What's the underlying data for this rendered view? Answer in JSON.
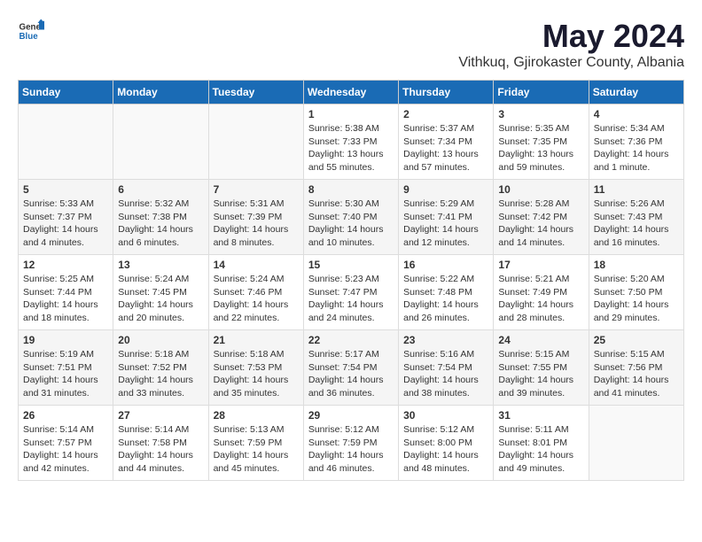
{
  "header": {
    "logo_general": "General",
    "logo_blue": "Blue",
    "month_year": "May 2024",
    "location": "Vithkuq, Gjirokaster County, Albania"
  },
  "days_of_week": [
    "Sunday",
    "Monday",
    "Tuesday",
    "Wednesday",
    "Thursday",
    "Friday",
    "Saturday"
  ],
  "weeks": [
    [
      {
        "day": null,
        "sunrise": null,
        "sunset": null,
        "daylight": null
      },
      {
        "day": null,
        "sunrise": null,
        "sunset": null,
        "daylight": null
      },
      {
        "day": null,
        "sunrise": null,
        "sunset": null,
        "daylight": null
      },
      {
        "day": "1",
        "sunrise": "Sunrise: 5:38 AM",
        "sunset": "Sunset: 7:33 PM",
        "daylight": "Daylight: 13 hours and 55 minutes."
      },
      {
        "day": "2",
        "sunrise": "Sunrise: 5:37 AM",
        "sunset": "Sunset: 7:34 PM",
        "daylight": "Daylight: 13 hours and 57 minutes."
      },
      {
        "day": "3",
        "sunrise": "Sunrise: 5:35 AM",
        "sunset": "Sunset: 7:35 PM",
        "daylight": "Daylight: 13 hours and 59 minutes."
      },
      {
        "day": "4",
        "sunrise": "Sunrise: 5:34 AM",
        "sunset": "Sunset: 7:36 PM",
        "daylight": "Daylight: 14 hours and 1 minute."
      }
    ],
    [
      {
        "day": "5",
        "sunrise": "Sunrise: 5:33 AM",
        "sunset": "Sunset: 7:37 PM",
        "daylight": "Daylight: 14 hours and 4 minutes."
      },
      {
        "day": "6",
        "sunrise": "Sunrise: 5:32 AM",
        "sunset": "Sunset: 7:38 PM",
        "daylight": "Daylight: 14 hours and 6 minutes."
      },
      {
        "day": "7",
        "sunrise": "Sunrise: 5:31 AM",
        "sunset": "Sunset: 7:39 PM",
        "daylight": "Daylight: 14 hours and 8 minutes."
      },
      {
        "day": "8",
        "sunrise": "Sunrise: 5:30 AM",
        "sunset": "Sunset: 7:40 PM",
        "daylight": "Daylight: 14 hours and 10 minutes."
      },
      {
        "day": "9",
        "sunrise": "Sunrise: 5:29 AM",
        "sunset": "Sunset: 7:41 PM",
        "daylight": "Daylight: 14 hours and 12 minutes."
      },
      {
        "day": "10",
        "sunrise": "Sunrise: 5:28 AM",
        "sunset": "Sunset: 7:42 PM",
        "daylight": "Daylight: 14 hours and 14 minutes."
      },
      {
        "day": "11",
        "sunrise": "Sunrise: 5:26 AM",
        "sunset": "Sunset: 7:43 PM",
        "daylight": "Daylight: 14 hours and 16 minutes."
      }
    ],
    [
      {
        "day": "12",
        "sunrise": "Sunrise: 5:25 AM",
        "sunset": "Sunset: 7:44 PM",
        "daylight": "Daylight: 14 hours and 18 minutes."
      },
      {
        "day": "13",
        "sunrise": "Sunrise: 5:24 AM",
        "sunset": "Sunset: 7:45 PM",
        "daylight": "Daylight: 14 hours and 20 minutes."
      },
      {
        "day": "14",
        "sunrise": "Sunrise: 5:24 AM",
        "sunset": "Sunset: 7:46 PM",
        "daylight": "Daylight: 14 hours and 22 minutes."
      },
      {
        "day": "15",
        "sunrise": "Sunrise: 5:23 AM",
        "sunset": "Sunset: 7:47 PM",
        "daylight": "Daylight: 14 hours and 24 minutes."
      },
      {
        "day": "16",
        "sunrise": "Sunrise: 5:22 AM",
        "sunset": "Sunset: 7:48 PM",
        "daylight": "Daylight: 14 hours and 26 minutes."
      },
      {
        "day": "17",
        "sunrise": "Sunrise: 5:21 AM",
        "sunset": "Sunset: 7:49 PM",
        "daylight": "Daylight: 14 hours and 28 minutes."
      },
      {
        "day": "18",
        "sunrise": "Sunrise: 5:20 AM",
        "sunset": "Sunset: 7:50 PM",
        "daylight": "Daylight: 14 hours and 29 minutes."
      }
    ],
    [
      {
        "day": "19",
        "sunrise": "Sunrise: 5:19 AM",
        "sunset": "Sunset: 7:51 PM",
        "daylight": "Daylight: 14 hours and 31 minutes."
      },
      {
        "day": "20",
        "sunrise": "Sunrise: 5:18 AM",
        "sunset": "Sunset: 7:52 PM",
        "daylight": "Daylight: 14 hours and 33 minutes."
      },
      {
        "day": "21",
        "sunrise": "Sunrise: 5:18 AM",
        "sunset": "Sunset: 7:53 PM",
        "daylight": "Daylight: 14 hours and 35 minutes."
      },
      {
        "day": "22",
        "sunrise": "Sunrise: 5:17 AM",
        "sunset": "Sunset: 7:54 PM",
        "daylight": "Daylight: 14 hours and 36 minutes."
      },
      {
        "day": "23",
        "sunrise": "Sunrise: 5:16 AM",
        "sunset": "Sunset: 7:54 PM",
        "daylight": "Daylight: 14 hours and 38 minutes."
      },
      {
        "day": "24",
        "sunrise": "Sunrise: 5:15 AM",
        "sunset": "Sunset: 7:55 PM",
        "daylight": "Daylight: 14 hours and 39 minutes."
      },
      {
        "day": "25",
        "sunrise": "Sunrise: 5:15 AM",
        "sunset": "Sunset: 7:56 PM",
        "daylight": "Daylight: 14 hours and 41 minutes."
      }
    ],
    [
      {
        "day": "26",
        "sunrise": "Sunrise: 5:14 AM",
        "sunset": "Sunset: 7:57 PM",
        "daylight": "Daylight: 14 hours and 42 minutes."
      },
      {
        "day": "27",
        "sunrise": "Sunrise: 5:14 AM",
        "sunset": "Sunset: 7:58 PM",
        "daylight": "Daylight: 14 hours and 44 minutes."
      },
      {
        "day": "28",
        "sunrise": "Sunrise: 5:13 AM",
        "sunset": "Sunset: 7:59 PM",
        "daylight": "Daylight: 14 hours and 45 minutes."
      },
      {
        "day": "29",
        "sunrise": "Sunrise: 5:12 AM",
        "sunset": "Sunset: 7:59 PM",
        "daylight": "Daylight: 14 hours and 46 minutes."
      },
      {
        "day": "30",
        "sunrise": "Sunrise: 5:12 AM",
        "sunset": "Sunset: 8:00 PM",
        "daylight": "Daylight: 14 hours and 48 minutes."
      },
      {
        "day": "31",
        "sunrise": "Sunrise: 5:11 AM",
        "sunset": "Sunset: 8:01 PM",
        "daylight": "Daylight: 14 hours and 49 minutes."
      },
      {
        "day": null,
        "sunrise": null,
        "sunset": null,
        "daylight": null
      }
    ]
  ]
}
